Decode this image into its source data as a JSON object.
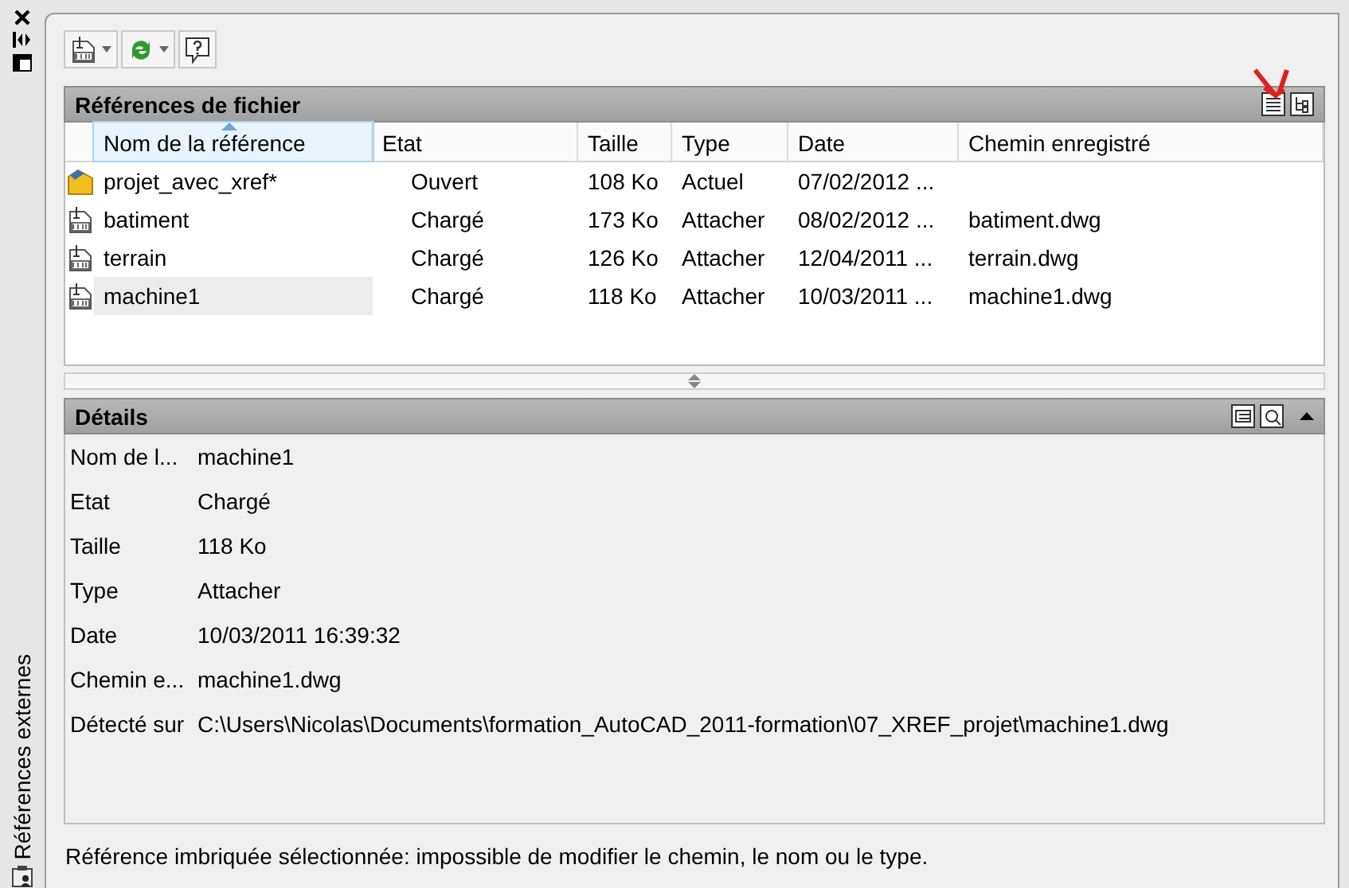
{
  "palette": {
    "title": "Références externes"
  },
  "file_references": {
    "title": "Références de fichier",
    "columns": [
      {
        "label": "Nom de la référence",
        "sorted": true
      },
      {
        "label": "Etat",
        "sorted": false
      },
      {
        "label": "Taille",
        "sorted": false
      },
      {
        "label": "Type",
        "sorted": false
      },
      {
        "label": "Date",
        "sorted": false
      },
      {
        "label": "Chemin enregistré",
        "sorted": false
      }
    ],
    "rows": [
      {
        "kind": "current",
        "name": "projet_avec_xref*",
        "status": "Ouvert",
        "size": "108 Ko",
        "type": "Actuel",
        "date": "07/02/2012 ...",
        "selected": false
      },
      {
        "kind": "dwg",
        "name": "batiment",
        "status": "Chargé",
        "size": "173 Ko",
        "type": "Attacher",
        "date": "08/02/2012 ...",
        "path": "batiment.dwg",
        "selected": false
      },
      {
        "kind": "dwg",
        "name": "terrain",
        "status": "Chargé",
        "size": "126 Ko",
        "type": "Attacher",
        "date": "12/04/2011 ...",
        "path": "terrain.dwg",
        "selected": false
      },
      {
        "kind": "dwg",
        "name": "machine1",
        "status": "Chargé",
        "size": "118 Ko",
        "type": "Attacher",
        "date": "10/03/2011 ...",
        "path": "machine1.dwg",
        "selected": true
      }
    ]
  },
  "details": {
    "title": "Détails",
    "fields": [
      {
        "label": "Nom de l...",
        "value": "machine1"
      },
      {
        "label": "Etat",
        "value": "Chargé"
      },
      {
        "label": "Taille",
        "value": "118 Ko"
      },
      {
        "label": "Type",
        "value": "Attacher"
      },
      {
        "label": "Date",
        "value": "10/03/2011 16:39:32"
      },
      {
        "label": "Chemin e...",
        "value": "machine1.dwg"
      },
      {
        "label": "Détecté sur",
        "value": "C:\\Users\\Nicolas\\Documents\\formation_AutoCAD_2011-formation\\07_XREF_projet\\machine1.dwg"
      }
    ]
  },
  "status_bar": "Référence imbriquée sélectionnée: impossible de modifier le chemin, le nom ou le type."
}
